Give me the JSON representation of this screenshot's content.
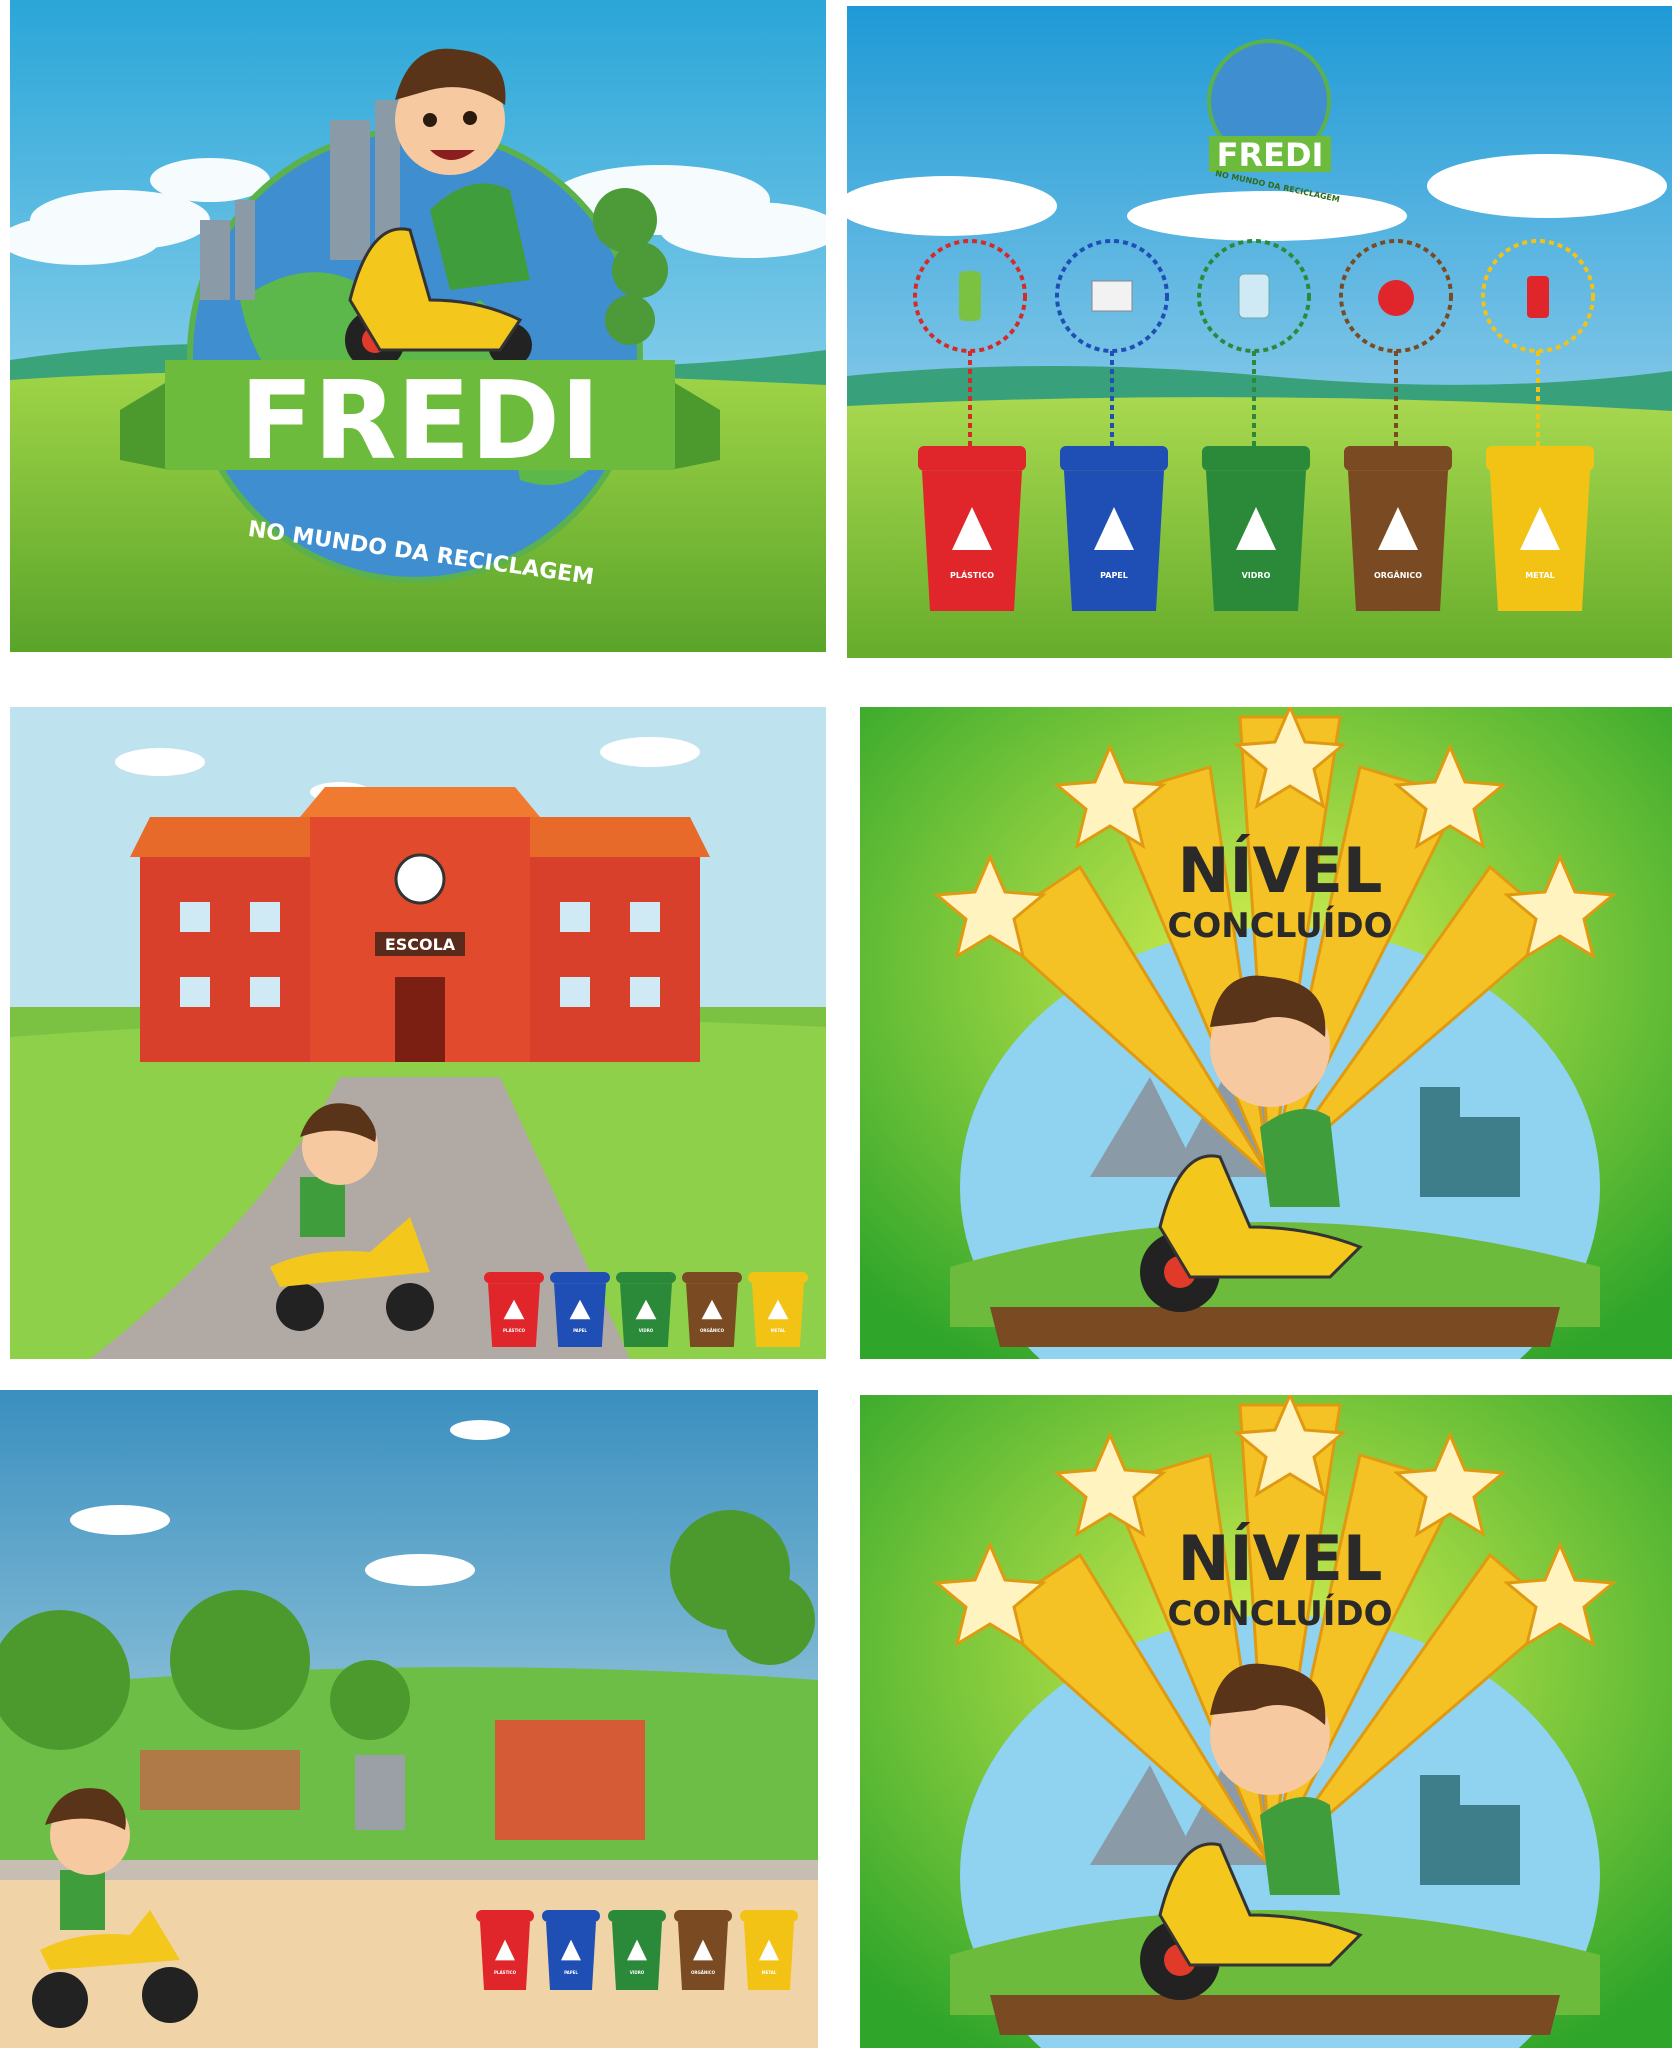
{
  "title_screen": {
    "game_title": "FREDI",
    "subtitle": "NO MUNDO DA RECICLAGEM"
  },
  "sorting_screen": {
    "logo_title": "FREDI",
    "logo_subtitle": "NO MUNDO DA RECICLAGEM",
    "bins": [
      {
        "label": "PLÁSTICO",
        "color": "#e0262b",
        "item_icon": "plastic-bottle-icon"
      },
      {
        "label": "PAPEL",
        "color": "#1f4fb5",
        "item_icon": "newspaper-icon"
      },
      {
        "label": "VIDRO",
        "color": "#2b8a3a",
        "item_icon": "glass-jar-icon"
      },
      {
        "label": "ORGÂNICO",
        "color": "#7a4a22",
        "item_icon": "apple-icon"
      },
      {
        "label": "METAL",
        "color": "#f2c315",
        "item_icon": "soda-can-icon"
      }
    ]
  },
  "school_screen": {
    "sign": "ESCOLA",
    "bins": [
      "PLÁSTICO",
      "PAPEL",
      "VIDRO",
      "ORGÂNICO",
      "METAL"
    ]
  },
  "level_complete_1": {
    "line1": "NÍVEL",
    "line2": "CONCLUÍDO"
  },
  "park_screen": {
    "bins": [
      "PLÁSTICO",
      "PAPEL",
      "VIDRO",
      "ORGÂNICO",
      "METAL"
    ]
  },
  "level_complete_2": {
    "line1": "NÍVEL",
    "line2": "CONCLUÍDO"
  },
  "colors": {
    "sky": "#3fa9dc",
    "grass": "#7cc242",
    "banner_green": "#6dbb3c",
    "star_gold": "#f5c226",
    "scooter_yellow": "#f4c71c",
    "school_red": "#d8402c"
  }
}
